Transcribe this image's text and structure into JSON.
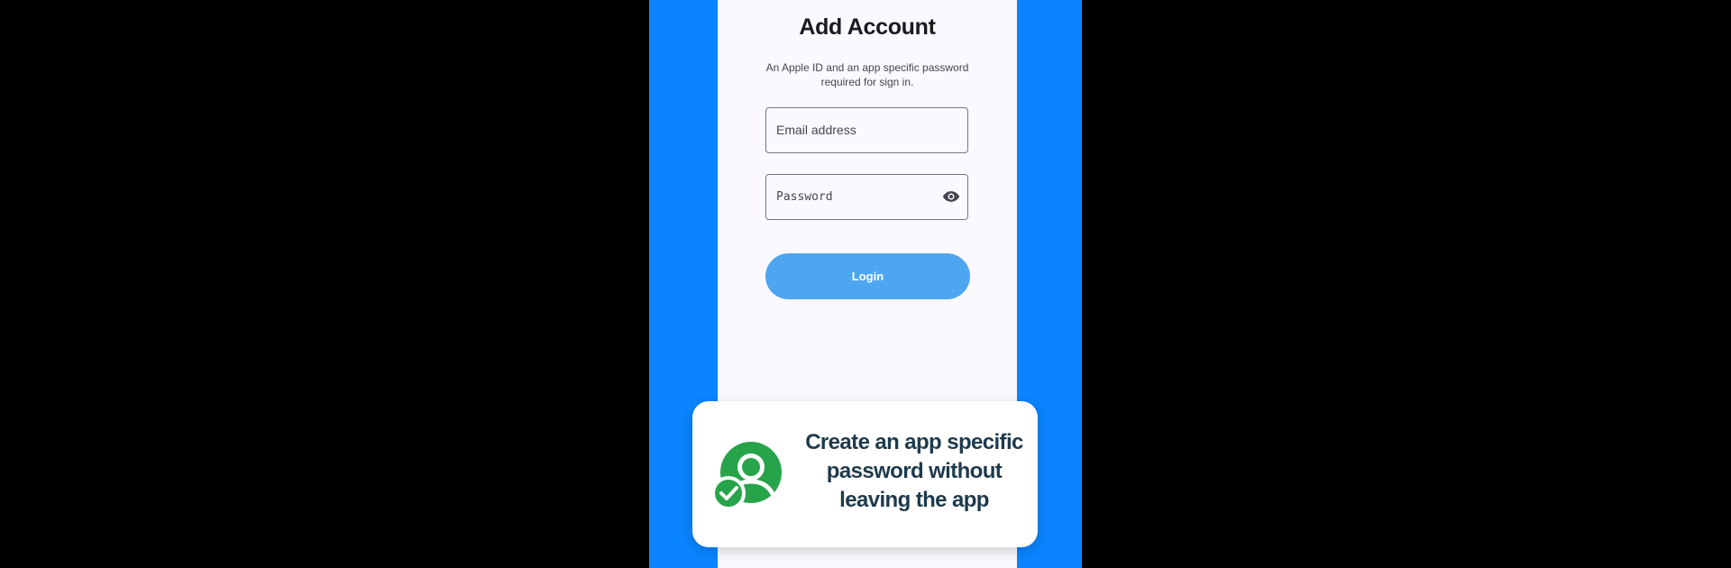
{
  "screen": {
    "title": "Add Account",
    "subtitle": "An Apple ID and an app specific password required for sign in."
  },
  "form": {
    "email_placeholder": "Email address",
    "password_placeholder": "Password",
    "login_label": "Login"
  },
  "icons": {
    "password_toggle": "eye-icon",
    "feature": "user-check-icon"
  },
  "feature_card": {
    "text": "Create an app specific password without leaving the app"
  },
  "colors": {
    "promo_background": "#0a84ff",
    "screen_background": "#fbf9fd",
    "login_button": "#4ea6f1",
    "feature_icon": "#27a44a",
    "feature_text": "#1e3a4c"
  }
}
